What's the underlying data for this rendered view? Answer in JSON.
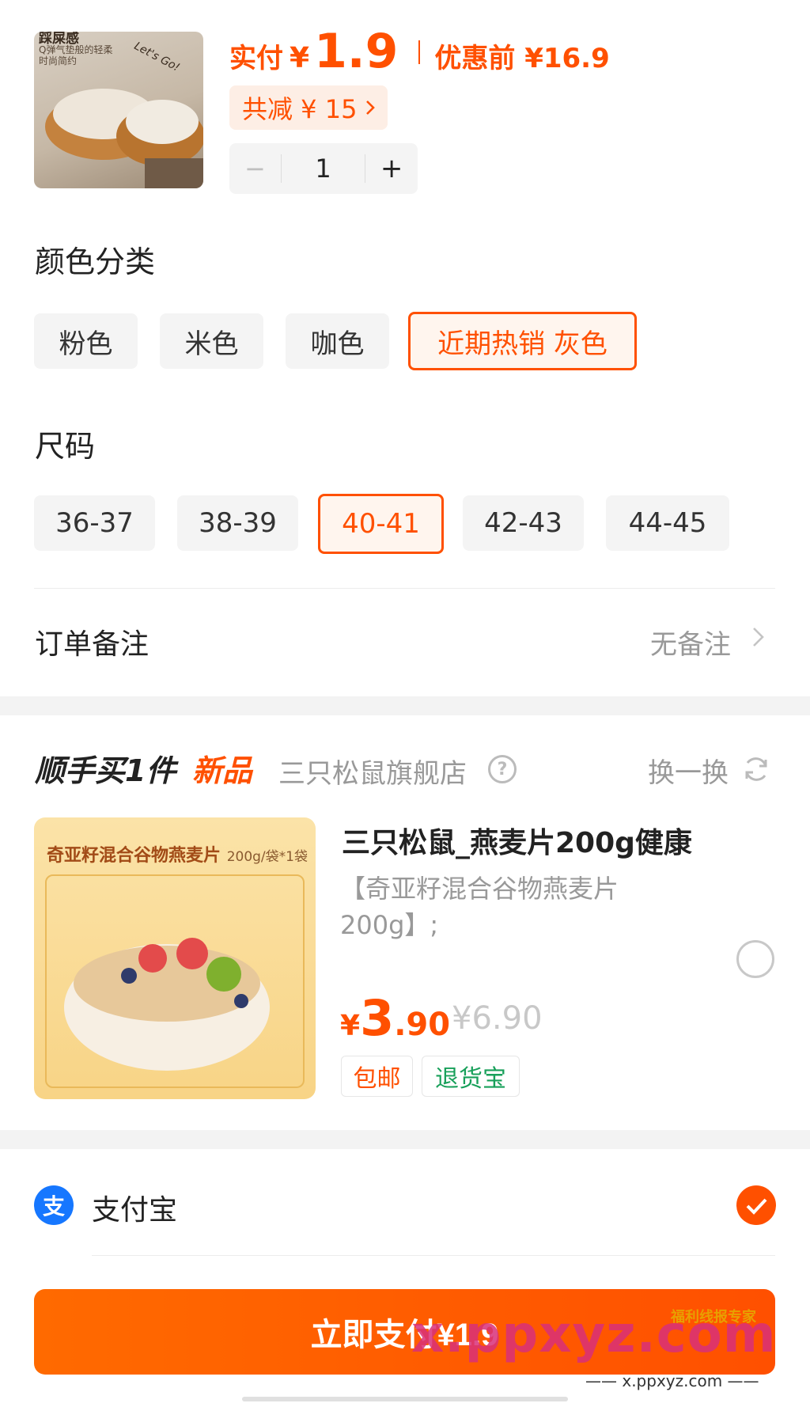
{
  "product": {
    "image_text_top": "踩屎感",
    "image_text_line1": "Q弹气垫般的轻柔",
    "image_text_line2": "时尚简约",
    "image_script": "Let's Go!",
    "paid_label": "实付",
    "paid_currency": "¥",
    "paid_amount": "1.9",
    "original_label": "优惠前 ¥16.9",
    "discount_text": "共减 ¥ 15",
    "quantity": "1",
    "minus_symbol": "−",
    "plus_symbol": "+"
  },
  "color_section": {
    "title": "颜色分类",
    "options": [
      "粉色",
      "米色",
      "咖色",
      "近期热销  灰色"
    ],
    "selected_index": 3
  },
  "size_section": {
    "title": "尺码",
    "options": [
      "36-37",
      "38-39",
      "40-41",
      "42-43",
      "44-45"
    ],
    "selected_index": 2
  },
  "order_note": {
    "label": "订单备注",
    "value": "无备注"
  },
  "addon": {
    "title": "顺手买1件",
    "title_highlight": "新品",
    "store": "三只松鼠旗舰店",
    "help_symbol": "?",
    "swap_label": "换一换",
    "image_banner": "奇亚籽混合谷物燕麦片",
    "image_banner_spec": "200g/袋*1袋",
    "name": "三只松鼠_燕麦片200g健康",
    "desc": "【奇亚籽混合谷物燕麦片200g】;",
    "price_currency": "¥",
    "price_int": "3",
    "price_dec": ".90",
    "original_price": "¥6.90",
    "tags": [
      "包邮",
      "退货宝"
    ]
  },
  "payment": {
    "method_icon_glyph": "支",
    "method_label": "支付宝",
    "selected": true,
    "pay_button_label": "立即支付¥1.9"
  },
  "watermark": {
    "text": "x.ppxyz.com",
    "sub": "—— x.ppxyz.com ——",
    "badge": "福利线报专家"
  },
  "colors": {
    "accent": "#ff5000",
    "accent_bg": "#fdeee5",
    "chip_bg": "#f4f4f4",
    "muted": "#999999",
    "alipay_blue": "#1677ff",
    "green": "#18a05a"
  }
}
